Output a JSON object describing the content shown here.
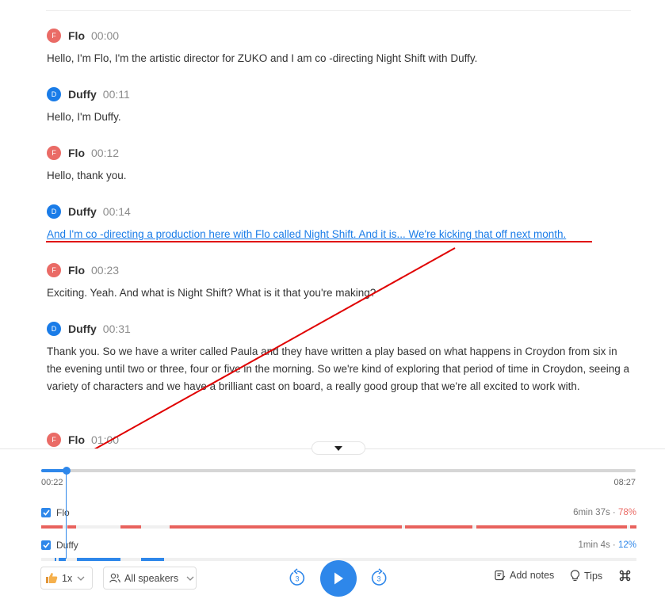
{
  "transcript": [
    {
      "speaker": "Flo",
      "initial": "F",
      "time": "00:00",
      "text": "Hello, I'm Flo, I'm the artistic director for ZUKO and I am co -directing Night Shift with Duffy."
    },
    {
      "speaker": "Duffy",
      "initial": "D",
      "time": "00:11",
      "text": "Hello, I'm Duffy."
    },
    {
      "speaker": "Flo",
      "initial": "F",
      "time": "00:12",
      "text": "Hello, thank you."
    },
    {
      "speaker": "Duffy",
      "initial": "D",
      "time": "00:14",
      "text": "And I'm co -directing a production here with Flo called Night Shift. And it is... We're kicking that off next month."
    },
    {
      "speaker": "Flo",
      "initial": "F",
      "time": "00:23",
      "text": "Exciting. Yeah. And what is Night Shift? What is it that you're making?"
    },
    {
      "speaker": "Duffy",
      "initial": "D",
      "time": "00:31",
      "text": "Thank you. So we have a writer called Paula and they have written a play based on what happens in Croydon from six in the evening until two or three, four or five in the morning. So we're kind of exploring that period of time in Croydon, seeing a variety of characters and we have a brilliant cast on board, a really good group that we're all excited to work with."
    },
    {
      "speaker": "Flo",
      "initial": "F",
      "time": "01:00",
      "text": ""
    }
  ],
  "player": {
    "current_time": "00:22",
    "total_time": "08:27",
    "progress": 0.043,
    "tracks": [
      {
        "name": "Flo",
        "duration": "6min 37s",
        "sep": " · ",
        "percent": "78%"
      },
      {
        "name": "Duffy",
        "duration": "1min 4s",
        "sep": " · ",
        "percent": "12%"
      }
    ],
    "speed": "1x",
    "speakers_filter": "All speakers",
    "skip_back": "3",
    "skip_forward": "3",
    "add_notes": "Add notes",
    "tips": "Tips"
  },
  "colors": {
    "accent": "#2e87ea",
    "flo": "#ea6b66",
    "duffy": "#1a7ce8",
    "annotation": "#e00000"
  },
  "icons": [
    "collapse-icon",
    "checkbox-check-icon",
    "thumbs-up-icon",
    "chevron-down-icon",
    "user-group-icon",
    "rewind-3-icon",
    "play-icon",
    "forward-3-icon",
    "notes-icon",
    "lightbulb-icon",
    "command-icon"
  ]
}
